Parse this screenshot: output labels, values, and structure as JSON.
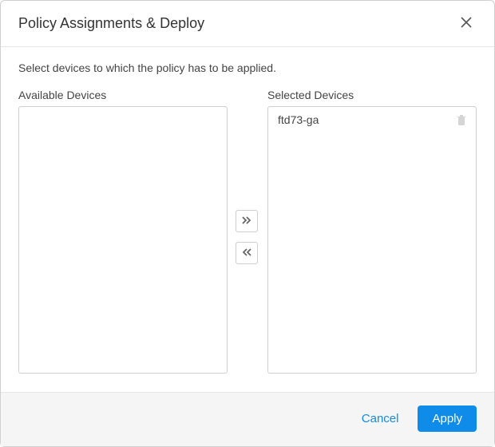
{
  "dialog": {
    "title": "Policy Assignments & Deploy",
    "instruction": "Select devices to which the policy has to be applied."
  },
  "transfer": {
    "available_label": "Available Devices",
    "selected_label": "Selected Devices",
    "available_items": [],
    "selected_items": [
      {
        "name": "ftd73-ga"
      }
    ]
  },
  "footer": {
    "cancel": "Cancel",
    "apply": "Apply"
  }
}
